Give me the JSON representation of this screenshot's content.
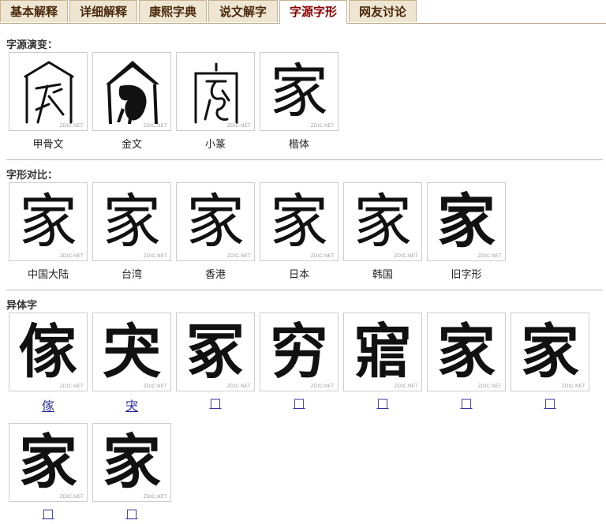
{
  "tabs": [
    {
      "label": "基本解释"
    },
    {
      "label": "详细解释"
    },
    {
      "label": "康熙字典"
    },
    {
      "label": "说文解字"
    },
    {
      "label": "字源字形",
      "active": true
    },
    {
      "label": "网友讨论"
    }
  ],
  "watermark": "ZDIC.NET",
  "evolution": {
    "title": "字源演变：",
    "items": [
      {
        "caption": "甲骨文",
        "glyph": "家"
      },
      {
        "caption": "金文",
        "glyph": "家"
      },
      {
        "caption": "小篆",
        "glyph": "家"
      },
      {
        "caption": "楷体",
        "glyph": "家"
      }
    ]
  },
  "comparison": {
    "title": "字形对比：",
    "items": [
      {
        "caption": "中国大陆",
        "glyph": "家"
      },
      {
        "caption": "台湾",
        "glyph": "家"
      },
      {
        "caption": "香港",
        "glyph": "家"
      },
      {
        "caption": "日本",
        "glyph": "家"
      },
      {
        "caption": "韩国",
        "glyph": "家"
      },
      {
        "caption": "旧字形",
        "glyph": "家"
      }
    ]
  },
  "variants": {
    "title": "异体字",
    "items": [
      {
        "glyph": "傢",
        "caption": "傢"
      },
      {
        "glyph": "宊",
        "caption": "宊"
      },
      {
        "glyph": "冢",
        "caption": "□"
      },
      {
        "glyph": "穷",
        "caption": "□"
      },
      {
        "glyph": "寣",
        "caption": "□"
      },
      {
        "glyph": "家",
        "caption": "□"
      },
      {
        "glyph": "家",
        "caption": "□"
      },
      {
        "glyph": "家",
        "caption": "□"
      },
      {
        "glyph": "家",
        "caption": "□"
      }
    ]
  }
}
